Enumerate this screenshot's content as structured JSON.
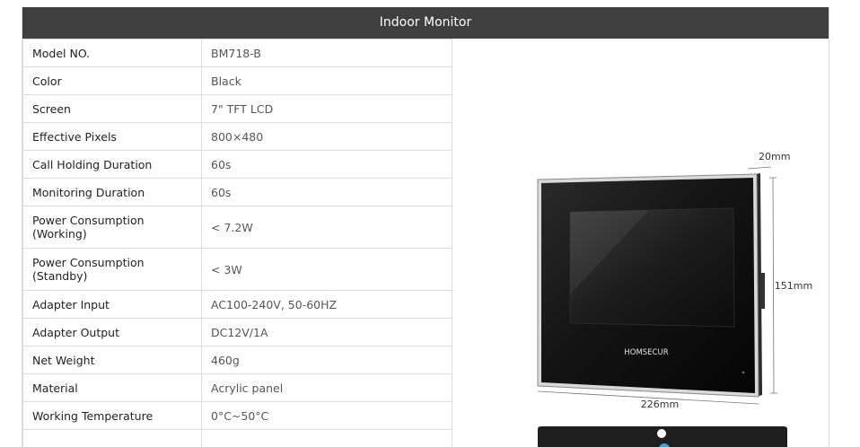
{
  "header": {
    "title": "Indoor Monitor"
  },
  "specs": [
    {
      "key": "Model NO.",
      "value": "BM718-B"
    },
    {
      "key": "Color",
      "value": "Black"
    },
    {
      "key": "Screen",
      "value": "7\" TFT LCD"
    },
    {
      "key": "Effective Pixels",
      "value": "800×480"
    },
    {
      "key": "Call Holding Duration",
      "value": "60s"
    },
    {
      "key": "Monitoring Duration",
      "value": "60s"
    },
    {
      "key": "Power Consumption (Working)",
      "value": "< 7.2W"
    },
    {
      "key": "Power Consumption (Standby)",
      "value": "< 3W"
    },
    {
      "key": "Adapter Input",
      "value": "AC100-240V, 50-60HZ"
    },
    {
      "key": "Adapter Output",
      "value": "DC12V/1A"
    },
    {
      "key": "Net Weight",
      "value": "460g"
    },
    {
      "key": "Material",
      "value": "Acrylic panel"
    },
    {
      "key": "Working Temperature",
      "value": "0°C~50°C"
    },
    {
      "key": "",
      "value": ""
    }
  ],
  "product": {
    "brand": "HOMSECUR",
    "depth_label": "20mm",
    "height_label": "151mm",
    "width_label": "226mm"
  }
}
